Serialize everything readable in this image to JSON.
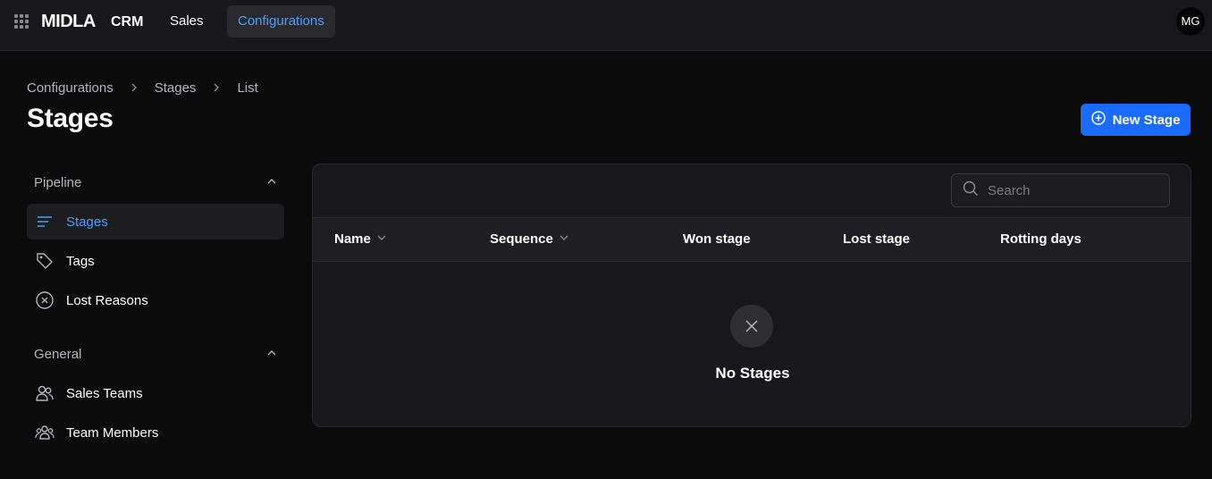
{
  "topbar": {
    "brand": "MIDLA",
    "product": "CRM",
    "nav": [
      {
        "label": "Sales"
      },
      {
        "label": "Configurations",
        "active": true
      }
    ],
    "avatar_initials": "MG"
  },
  "breadcrumb": [
    "Configurations",
    "Stages",
    "List"
  ],
  "page_title": "Stages",
  "new_button_label": "New Stage",
  "sidebar": {
    "groups": [
      {
        "title": "Pipeline",
        "items": [
          {
            "label": "Stages",
            "icon": "list-icon",
            "active": true
          },
          {
            "label": "Tags",
            "icon": "tag-icon"
          },
          {
            "label": "Lost Reasons",
            "icon": "circle-x-icon"
          }
        ]
      },
      {
        "title": "General",
        "items": [
          {
            "label": "Sales Teams",
            "icon": "users-icon"
          },
          {
            "label": "Team Members",
            "icon": "group-icon"
          }
        ]
      }
    ]
  },
  "table": {
    "search_placeholder": "Search",
    "columns": [
      {
        "label": "Name",
        "sortable": true
      },
      {
        "label": "Sequence",
        "sortable": true
      },
      {
        "label": "Won stage"
      },
      {
        "label": "Lost stage"
      },
      {
        "label": "Rotting days"
      }
    ],
    "empty_text": "No Stages"
  },
  "colors": {
    "accent": "#1a6bff",
    "active_text": "#4a9eff",
    "background": "#0b0b0c",
    "panel": "#18181a"
  }
}
